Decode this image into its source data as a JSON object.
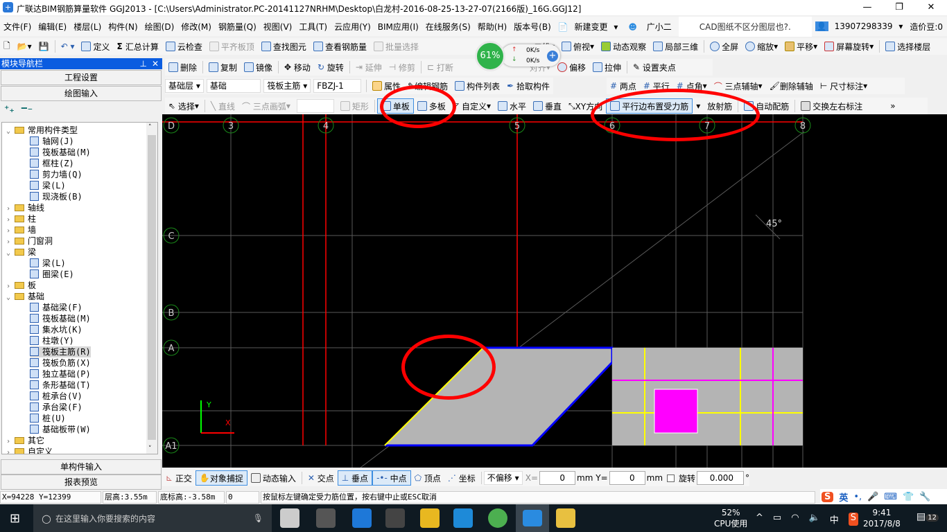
{
  "title": "广联达BIM钢筋算量软件 GGJ2013 - [C:\\Users\\Administrator.PC-20141127NRHM\\Desktop\\白龙村-2016-08-25-13-27-07(2166版)_16G.GGJ12]",
  "menu": [
    "文件(F)",
    "编辑(E)",
    "楼层(L)",
    "构件(N)",
    "绘图(D)",
    "修改(M)",
    "钢筋量(Q)",
    "视图(V)",
    "工具(T)",
    "云应用(Y)",
    "BIM应用(I)",
    "在线服务(S)",
    "帮助(H)",
    "版本号(B)"
  ],
  "menu_right": {
    "new_change": "新建变更",
    "assistant": "广小二",
    "notice": "CAD图纸不区分图层也?.",
    "account": "13907298339",
    "beans": "造价豆:0"
  },
  "toolbar1": [
    "定义",
    "汇总计算",
    "云检查",
    "平齐板顶",
    "查找图元",
    "查看钢筋量",
    "批量选择"
  ],
  "toolbar1_right": [
    "二维",
    "俯视",
    "动态观察",
    "局部三维",
    "全屏",
    "缩放",
    "平移",
    "屏幕旋转",
    "选择楼层"
  ],
  "widget": {
    "percent": "61%",
    "up": "0K/s",
    "down": "0K/s"
  },
  "toolbar2": [
    "删除",
    "复制",
    "镜像",
    "移动",
    "旋转",
    "延伸",
    "修剪",
    "打断",
    "对齐",
    "偏移",
    "拉伸",
    "设置夹点"
  ],
  "toolbar3": {
    "floor": "基础层",
    "category": "基础",
    "type": "筏板主筋",
    "name": "FBZJ-1",
    "buttons": [
      "属性",
      "编辑钢筋",
      "构件列表",
      "拾取构件"
    ],
    "axis_buttons": [
      "两点",
      "平行",
      "点角",
      "三点辅轴",
      "删除辅轴",
      "尺寸标注"
    ]
  },
  "toolbar4": [
    "选择",
    "直线",
    "三点画弧",
    "矩形",
    "单板",
    "多板",
    "自定义",
    "水平",
    "垂直",
    "XY方向",
    "平行边布置受力筋",
    "放射筋",
    "自动配筋",
    "交换左右标注"
  ],
  "nav": {
    "title": "模块导航栏",
    "project_settings": "工程设置",
    "drawing_input": "绘图输入",
    "single_input": "单构件输入",
    "report_preview": "报表预览",
    "tree": [
      {
        "label": "常用构件类型",
        "type": "folder",
        "open": true,
        "level": 0
      },
      {
        "label": "轴网(J)",
        "level": 1
      },
      {
        "label": "筏板基础(M)",
        "level": 1
      },
      {
        "label": "框柱(Z)",
        "level": 1
      },
      {
        "label": "剪力墙(Q)",
        "level": 1
      },
      {
        "label": "梁(L)",
        "level": 1
      },
      {
        "label": "现浇板(B)",
        "level": 1
      },
      {
        "label": "轴线",
        "type": "folder",
        "level": 0
      },
      {
        "label": "柱",
        "type": "folder",
        "level": 0
      },
      {
        "label": "墙",
        "type": "folder",
        "level": 0
      },
      {
        "label": "门窗洞",
        "type": "folder",
        "level": 0
      },
      {
        "label": "梁",
        "type": "folder",
        "open": true,
        "level": 0
      },
      {
        "label": "梁(L)",
        "level": 1
      },
      {
        "label": "圈梁(E)",
        "level": 1
      },
      {
        "label": "板",
        "type": "folder",
        "level": 0
      },
      {
        "label": "基础",
        "type": "folder",
        "open": true,
        "level": 0
      },
      {
        "label": "基础梁(F)",
        "level": 1
      },
      {
        "label": "筏板基础(M)",
        "level": 1
      },
      {
        "label": "集水坑(K)",
        "level": 1
      },
      {
        "label": "柱墩(Y)",
        "level": 1
      },
      {
        "label": "筏板主筋(R)",
        "level": 1,
        "selected": true
      },
      {
        "label": "筏板负筋(X)",
        "level": 1
      },
      {
        "label": "独立基础(P)",
        "level": 1
      },
      {
        "label": "条形基础(T)",
        "level": 1
      },
      {
        "label": "桩承台(V)",
        "level": 1
      },
      {
        "label": "承台梁(F)",
        "level": 1
      },
      {
        "label": "桩(U)",
        "level": 1
      },
      {
        "label": "基础板带(W)",
        "level": 1
      },
      {
        "label": "其它",
        "type": "folder",
        "level": 0
      },
      {
        "label": "自定义",
        "type": "folder",
        "level": 0
      }
    ]
  },
  "canvas": {
    "axes_x": [
      "3",
      "4",
      "5",
      "6",
      "7",
      "8"
    ],
    "axes_y": [
      "D",
      "C",
      "B",
      "A",
      "A1"
    ],
    "angle": "45°",
    "ucs_x": "X",
    "ucs_y": "Y"
  },
  "bottombar": {
    "buttons": [
      "正交",
      "对象捕捉",
      "动态输入",
      "交点",
      "垂点",
      "中点",
      "顶点",
      "坐标"
    ],
    "offset": "不偏移",
    "x_label": "X=",
    "x": "0",
    "y_label": "Y=",
    "y": "0",
    "unit": "mm",
    "rotate": "旋转",
    "rotate_val": "0.000",
    "deg": "°"
  },
  "status": {
    "coords": "X=94228 Y=12399",
    "floor_height": "层高:3.55m",
    "bottom_height": "底标高:-3.58m",
    "value": "0",
    "hint": "按鼠标左键确定受力筋位置，按右键中止或ESC取消"
  },
  "ime": {
    "lang": "英"
  },
  "taskbar": {
    "search": "在这里输入你要搜索的内容",
    "cpu": "52%",
    "cpu_label": "CPU使用",
    "ime": "中",
    "time": "9:41",
    "date": "2017/8/8",
    "notifications": "12"
  },
  "colors": {
    "canvas": "#000000",
    "axis": "#ff0000",
    "slab": "#b4b4b4",
    "edge": "#0000ff",
    "rebar": "#ffff00",
    "neg_rebar": "#ff00ff",
    "highlight": "#ff0000"
  }
}
